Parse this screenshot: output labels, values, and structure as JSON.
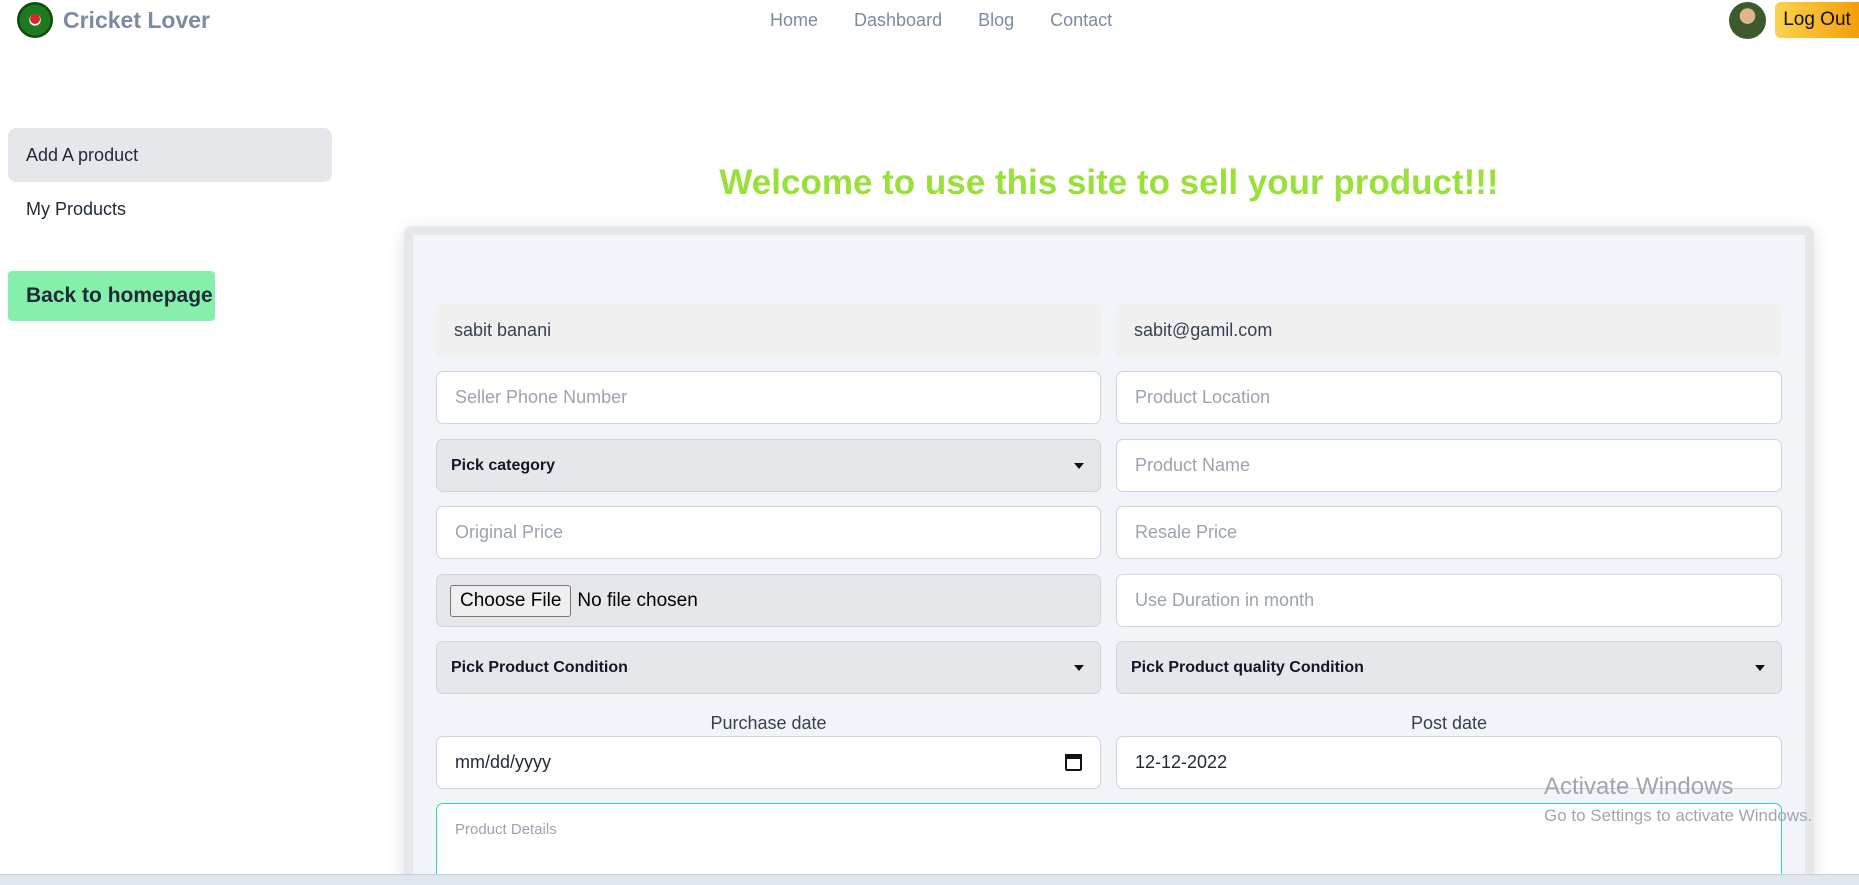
{
  "brand": {
    "name": "Cricket Lover"
  },
  "nav": {
    "links": [
      "Home",
      "Dashboard",
      "Blog",
      "Contact"
    ],
    "logout": "Log Out"
  },
  "sidebar": {
    "items": [
      {
        "label": "Add A product",
        "active": true
      },
      {
        "label": "My Products",
        "active": false
      }
    ],
    "back_button": "Back to homepage"
  },
  "main": {
    "heading": "Welcome to use this site to sell your product!!!",
    "form": {
      "seller_name": "sabit banani",
      "seller_email": "sabit@gamil.com",
      "phone_placeholder": "Seller Phone Number",
      "location_placeholder": "Product Location",
      "category_select": "Pick category",
      "product_name_placeholder": "Product Name",
      "original_price_placeholder": "Original Price",
      "resale_price_placeholder": "Resale Price",
      "file_button": "Choose File",
      "file_status": "No file chosen",
      "duration_placeholder": "Use Duration in month",
      "condition_select": "Pick Product Condition",
      "quality_select": "Pick Product quality Condition",
      "purchase_date_label": "Purchase date",
      "purchase_date_value": "mm/dd/yyyy",
      "post_date_label": "Post date",
      "post_date_value": "12-12-2022",
      "details_placeholder": "Product Details"
    }
  },
  "watermark": {
    "title": "Activate Windows",
    "subtitle": "Go to Settings to activate Windows."
  },
  "colors": {
    "heading": "#9ae03a",
    "back_button": "#86efac",
    "logout_button": "#f59e0b"
  }
}
